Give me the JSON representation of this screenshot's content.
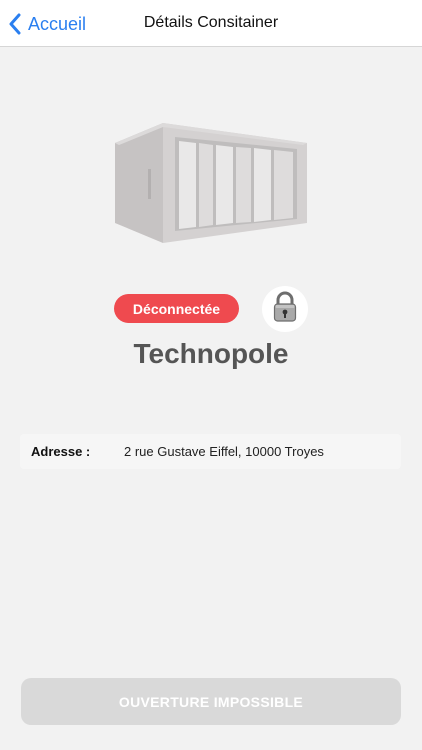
{
  "navbar": {
    "back_label": "Accueil",
    "title": "Détails Consitainer",
    "back_icon": "chevron-left-icon",
    "accent_color": "#2a7ff0"
  },
  "container": {
    "image": "shipping-container-icon",
    "status_label": "Déconnectée",
    "status_color": "#ef4a4f",
    "lock_icon": "padlock-icon",
    "name": "Technopole"
  },
  "address": {
    "label": "Adresse :",
    "value": "2 rue Gustave Eiffel, 10000 Troyes"
  },
  "action": {
    "open_label": "OUVERTURE IMPOSSIBLE",
    "disabled": true
  }
}
